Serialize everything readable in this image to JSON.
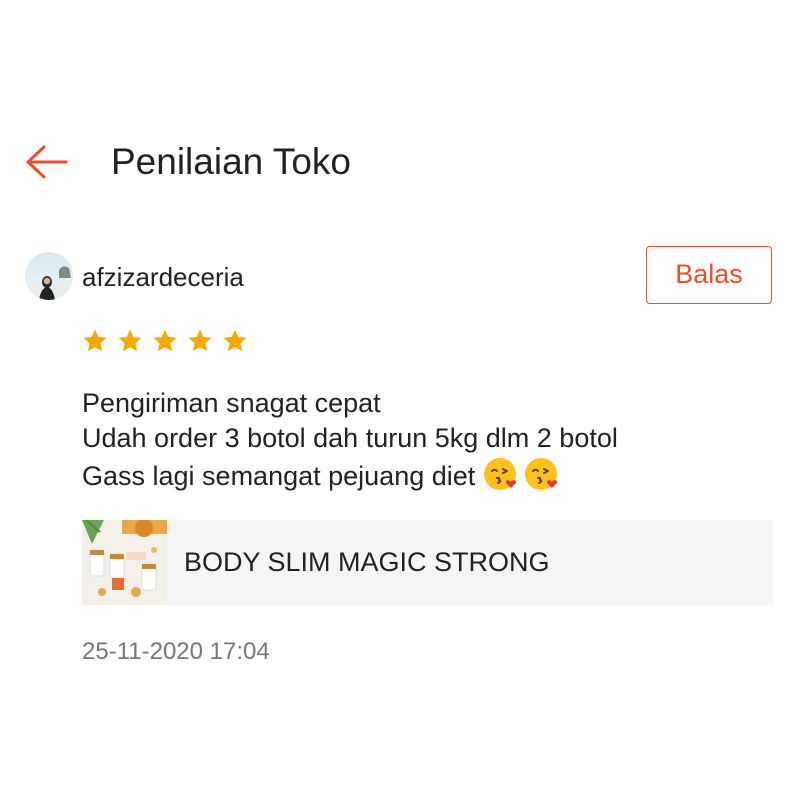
{
  "header": {
    "title": "Penilaian Toko",
    "back_icon": "arrow-left-icon"
  },
  "review": {
    "username": "afzizardeceria",
    "reply_label": "Balas",
    "rating": 5,
    "rating_max": 5,
    "text_lines": [
      "Pengiriman snagat cepat",
      "Udah order 3 botol dah turun 5kg dlm 2 botol",
      "Gass lagi semangat pejuang diet"
    ],
    "emojis": [
      "kissing-face-with-heart-emoji",
      "kissing-face-with-heart-emoji"
    ],
    "product": {
      "name": "BODY SLIM MAGIC STRONG"
    },
    "timestamp": "25-11-2020 17:04"
  },
  "colors": {
    "accent": "#ee4d2d",
    "star": "#f6a700",
    "card_bg": "#f5f5f5",
    "muted_text": "#777777"
  }
}
